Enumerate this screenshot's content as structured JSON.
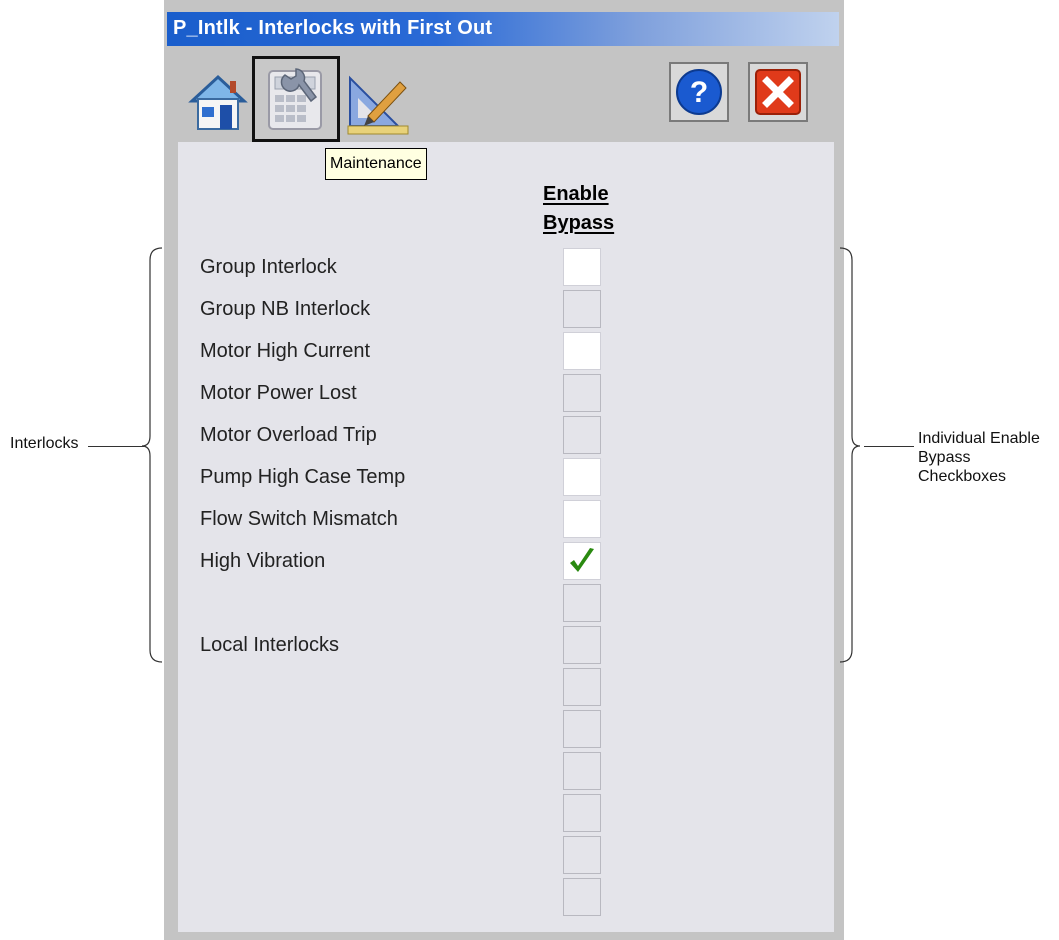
{
  "window": {
    "title": "P_Intlk - Interlocks with First Out"
  },
  "toolbar": {
    "home_icon": "home-icon",
    "maintenance_icon": "maintenance-icon",
    "engineering_icon": "engineering-icon",
    "help_icon": "help-icon",
    "close_icon": "close-icon",
    "tooltip": "Maintenance"
  },
  "column_header": {
    "line1": "Enable",
    "line2": "Bypass"
  },
  "interlocks": [
    {
      "label": "Group Interlock",
      "enabled": true,
      "checked": false
    },
    {
      "label": "Group NB Interlock",
      "enabled": false,
      "checked": false
    },
    {
      "label": "Motor High Current",
      "enabled": true,
      "checked": false
    },
    {
      "label": "Motor Power Lost",
      "enabled": false,
      "checked": false
    },
    {
      "label": "Motor Overload Trip",
      "enabled": false,
      "checked": false
    },
    {
      "label": "Pump High Case Temp",
      "enabled": true,
      "checked": false
    },
    {
      "label": "Flow Switch Mismatch",
      "enabled": true,
      "checked": false
    },
    {
      "label": "High Vibration",
      "enabled": true,
      "checked": true
    },
    {
      "label": "",
      "enabled": false,
      "checked": false
    },
    {
      "label": "Local Interlocks",
      "enabled": false,
      "checked": false
    },
    {
      "label": "",
      "enabled": false,
      "checked": false
    },
    {
      "label": "",
      "enabled": false,
      "checked": false
    },
    {
      "label": "",
      "enabled": false,
      "checked": false
    },
    {
      "label": "",
      "enabled": false,
      "checked": false
    },
    {
      "label": "",
      "enabled": false,
      "checked": false
    },
    {
      "label": "",
      "enabled": false,
      "checked": false
    }
  ],
  "annotations": {
    "left": "Interlocks",
    "right_line1": "Individual Enable",
    "right_line2": "Bypass Checkboxes"
  },
  "colors": {
    "titlebar": "#1a5ecc",
    "panel": "#e4e4ea",
    "check": "#2a8a10",
    "close": "#e03a1a",
    "help": "#1a5ad0"
  }
}
